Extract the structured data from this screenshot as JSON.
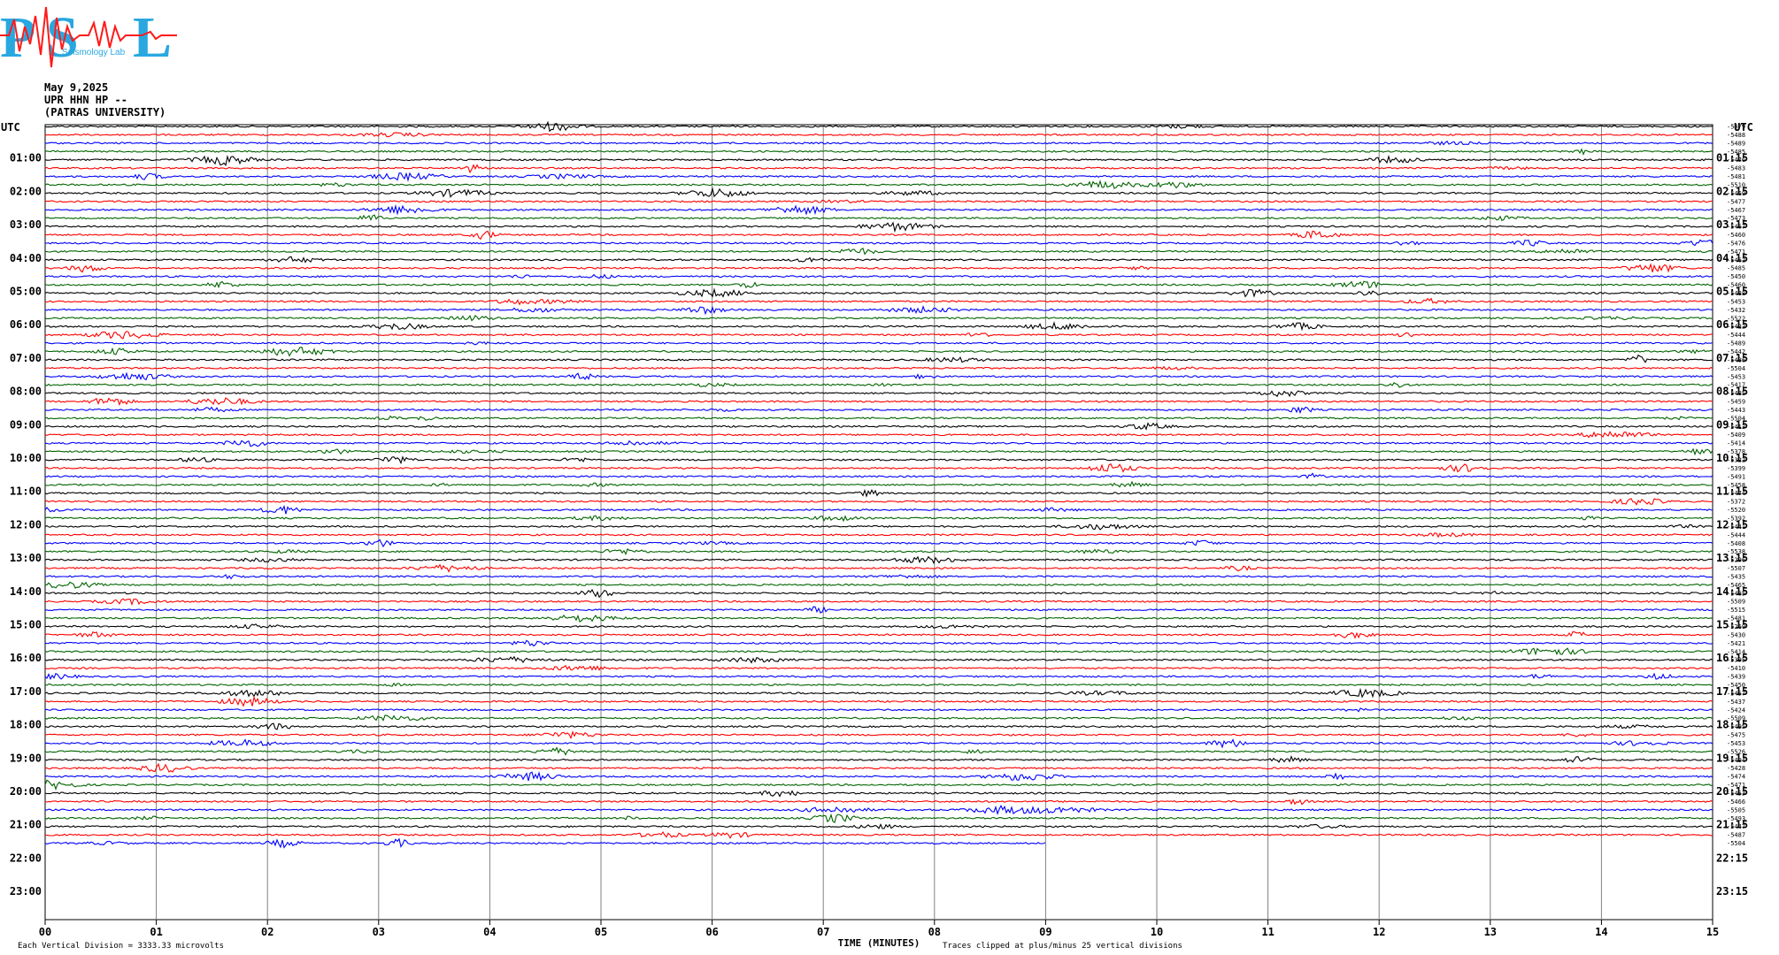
{
  "header": {
    "date": "May 9,2025",
    "station": "UPR HHN HP --",
    "institution": "(PATRAS UNIVERSITY)",
    "logo_text": "Seismology Lab"
  },
  "colors": {
    "trace_cycle": [
      "#000000",
      "#ff0000",
      "#0000ff",
      "#006400"
    ],
    "grid": "#808080",
    "logo_blue": "#29a8e0",
    "logo_red": "#ff1a1a"
  },
  "chart_data": {
    "type": "line",
    "title": "",
    "xlabel": "TIME (MINUTES)",
    "ylabel": "UTC",
    "xlim": [
      0,
      15
    ],
    "x_ticks": [
      "00",
      "01",
      "02",
      "03",
      "04",
      "05",
      "06",
      "07",
      "08",
      "09",
      "10",
      "11",
      "12",
      "13",
      "14",
      "15"
    ],
    "left_time_labels": [
      "01:00",
      "02:00",
      "03:00",
      "04:00",
      "05:00",
      "06:00",
      "07:00",
      "08:00",
      "09:00",
      "10:00",
      "11:00",
      "12:00",
      "13:00",
      "14:00",
      "15:00",
      "16:00",
      "17:00",
      "18:00",
      "19:00",
      "20:00",
      "21:00",
      "22:00",
      "23:00"
    ],
    "right_time_labels": [
      "01:15",
      "02:15",
      "03:15",
      "04:15",
      "05:15",
      "06:15",
      "07:15",
      "08:15",
      "09:15",
      "10:15",
      "11:15",
      "12:15",
      "13:15",
      "14:15",
      "15:15",
      "16:15",
      "17:15",
      "18:15",
      "19:15",
      "20:15",
      "21:15",
      "22:15",
      "23:15"
    ],
    "trace_rows_per_hour": 4,
    "last_trace_end_minute": 9,
    "trace_offsets": [
      "-5479",
      "-5488",
      "-5489",
      "-5485",
      "-5476",
      "-5483",
      "-5481",
      "-5510",
      "-5469",
      "-5477",
      "-5467",
      "-5473",
      "-5467",
      "-5460",
      "-5476",
      "-5471",
      "-5462",
      "-5485",
      "-5450",
      "-5460",
      "-5488",
      "-5453",
      "-5432",
      "-5522",
      "-5422",
      "-5444",
      "-5489",
      "-5442",
      "-5486",
      "-5504",
      "-5453",
      "-5417",
      "-5485",
      "-5459",
      "-5443",
      "-5504",
      "-5413",
      "-5409",
      "-5414",
      "-5378",
      "-5322",
      "-5399",
      "-5491",
      "-5458",
      "-5474",
      "-5372",
      "-5520",
      "-5392",
      "-5441",
      "-5444",
      "-5408",
      "-5538",
      "-5296",
      "-5507",
      "-5435",
      "-5465",
      "-5485",
      "-5509",
      "-5515",
      "-5481",
      "-5269",
      "-5430",
      "-5421",
      "-5414",
      "-5395",
      "-5410",
      "-5439",
      "-5450",
      "-5457",
      "-5437",
      "-5424",
      "-5509",
      "-5495",
      "-5475",
      "-5453",
      "-5526",
      "-5494",
      "-5428",
      "-5474",
      "-5471",
      "-5453",
      "-5466",
      "-5505",
      "-5493",
      "-5447",
      "-5487",
      "-5504"
    ],
    "footer_left": "Each Vertical Division = 3333.33 microvolts",
    "footer_right": "Traces clipped at plus/minus 25 vertical divisions",
    "grid": true,
    "legend": "none"
  }
}
